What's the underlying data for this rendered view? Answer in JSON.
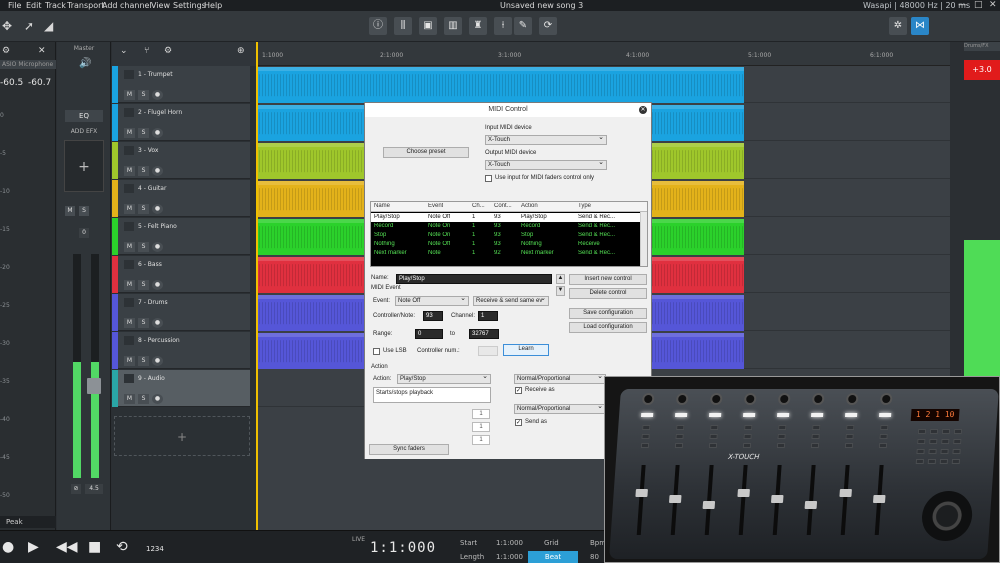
{
  "menu": {
    "items": [
      "File",
      "Edit",
      "Track",
      "Transport",
      "Add channel",
      "View",
      "Settings",
      "Help"
    ],
    "title": "Unsaved new song 3",
    "audio_info": "Wasapi | 48000 Hz | 20 ms"
  },
  "toolbar": {
    "icons": [
      "move-tool-icon",
      "pointer-tool-icon",
      "automation-tool-icon",
      "info-icon",
      "mixer-icon",
      "rack-icon",
      "piano-icon",
      "tuner-icon",
      "level-icon",
      "wrench-icon",
      "loop-icon",
      "routing-icon",
      "link-icon"
    ]
  },
  "left_strip": {
    "channel_name": "ASIO Microphone",
    "level_left": "-60.5",
    "level_right": "-60.7",
    "scale": [
      "0",
      "-5",
      "-10",
      "-15",
      "-20",
      "-25",
      "-30",
      "-35",
      "-40",
      "-45",
      "-50"
    ],
    "peak_label": "Peak"
  },
  "master": {
    "title": "Master",
    "eq_label": "EQ",
    "add_fx_label": "ADD EFX",
    "add_symbol": "+",
    "mute": "M",
    "solo": "S",
    "gain": "0",
    "pan_value": "4.5",
    "meter_level": 0.52
  },
  "tracks": [
    {
      "name": "1 - Trumpet",
      "color": "#1aa3e0"
    },
    {
      "name": "2 - Flugel Horn",
      "color": "#1aa3e0"
    },
    {
      "name": "3 - Vox",
      "color": "#9fc72b"
    },
    {
      "name": "4 - Guitar",
      "color": "#e3b21a"
    },
    {
      "name": "5 - Felt Piano",
      "color": "#2bd12b"
    },
    {
      "name": "6 - Bass",
      "color": "#e0303f"
    },
    {
      "name": "7 - Drums",
      "color": "#5556d8"
    },
    {
      "name": "8 - Percussion",
      "color": "#5556d8"
    },
    {
      "name": "9 - Audio",
      "color": "#2aa6a6"
    }
  ],
  "track_buttons": {
    "mute": "M",
    "solo": "S"
  },
  "add_track_symbol": "+",
  "ruler": {
    "marks": [
      "1:1000",
      "2:1:000",
      "3:1:000",
      "4:1:000",
      "5:1:000",
      "6:1:000"
    ]
  },
  "right_strip": {
    "channel_name": "Drums/FX Beats",
    "level": "+3.0"
  },
  "transport": {
    "live": "LIVE",
    "counter": "1234",
    "timecode": "1:1:000",
    "start_label": "Start",
    "start_value": "1:1:000",
    "length_label": "Length",
    "length_value": "1:1:000",
    "grid_label": "Grid",
    "grid_value": "Beat",
    "bpm_label": "Bpm",
    "bpm_value": "80"
  },
  "dialog": {
    "title": "MIDI Control",
    "choose_preset": "Choose preset",
    "input_device_label": "Input MIDI device",
    "input_device": "X-Touch",
    "output_device_label": "Output MIDI device",
    "output_device": "X-Touch",
    "faders_only_label": "Use input for MIDI faders control only",
    "table_headers": [
      "Name",
      "Event",
      "Ch...",
      "Cont...",
      "Action",
      "Type"
    ],
    "table_rows": [
      [
        "Play/Stop",
        "Note Off",
        "1",
        "93",
        "Play/Stop",
        "Send & Rec..."
      ],
      [
        "Record",
        "Note On",
        "1",
        "93",
        "Record",
        "Send & Rec..."
      ],
      [
        "Stop",
        "Note On",
        "1",
        "93",
        "Stop",
        "Send & Rec..."
      ],
      [
        "Nothing",
        "Note Off",
        "1",
        "93",
        "Nothing",
        "Receive"
      ],
      [
        "Next marker",
        "Note",
        "1",
        "92",
        "Next marker",
        "Send & Rec..."
      ]
    ],
    "name_label": "Name:",
    "name_value": "Play/Stop",
    "midi_event_label": "MIDI Event",
    "event_label": "Event:",
    "event_value": "Note Off",
    "receive_mode": "Receive & send same ev",
    "controller_label": "Controller/Note:",
    "controller_value": "93",
    "channel_label": "Channel:",
    "channel_value": "1",
    "range_label": "Range:",
    "range_from": "0",
    "range_to_label": "to",
    "range_to": "32767",
    "use_lsb_label": "Use LSB",
    "controller_num_label": "Controller num.:",
    "learn_label": "Learn",
    "insert_control": "Insert new control",
    "delete_control": "Delete control",
    "save_config": "Save configuration",
    "load_config": "Load configuration",
    "action_section": "Action",
    "action_label": "Action:",
    "action_value": "Play/Stop",
    "action_description": "Starts/stops playback",
    "receive_curve": "Normal/Proportional",
    "receive_as_label": "Receive as",
    "send_curve": "Normal/Proportional",
    "send_as_label": "Send as",
    "spin_values": [
      "1",
      "1",
      "1"
    ],
    "sync_faders": "Sync faders",
    "check_mark": "✓"
  },
  "webcam": {
    "device_brand": "X-TOUCH",
    "display_value": "1 2  1 10"
  }
}
